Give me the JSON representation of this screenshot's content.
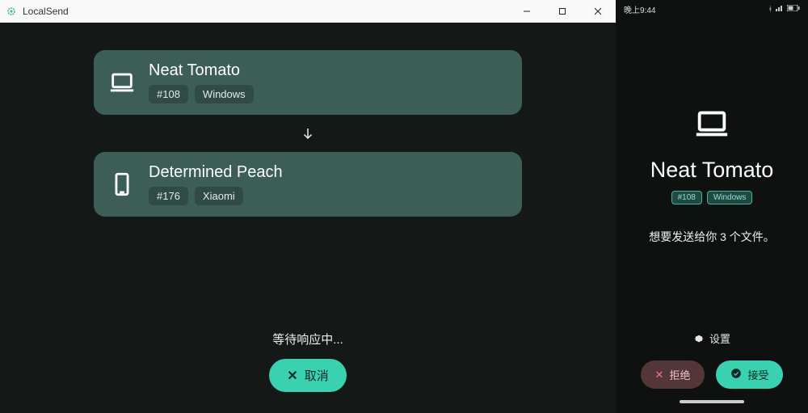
{
  "desktop": {
    "app_title": "LocalSend",
    "source": {
      "name": "Neat Tomato",
      "alias": "#108",
      "platform": "Windows"
    },
    "target": {
      "name": "Determined Peach",
      "alias": "#176",
      "platform": "Xiaomi"
    },
    "waiting_text": "等待响应中...",
    "cancel_label": "取消"
  },
  "phone": {
    "status_time": "晚上9:44",
    "sender": {
      "name": "Neat Tomato",
      "alias": "#108",
      "platform": "Windows"
    },
    "message": "想要发送给你 3 个文件。",
    "settings_label": "设置",
    "reject_label": "拒绝",
    "accept_label": "接受"
  }
}
